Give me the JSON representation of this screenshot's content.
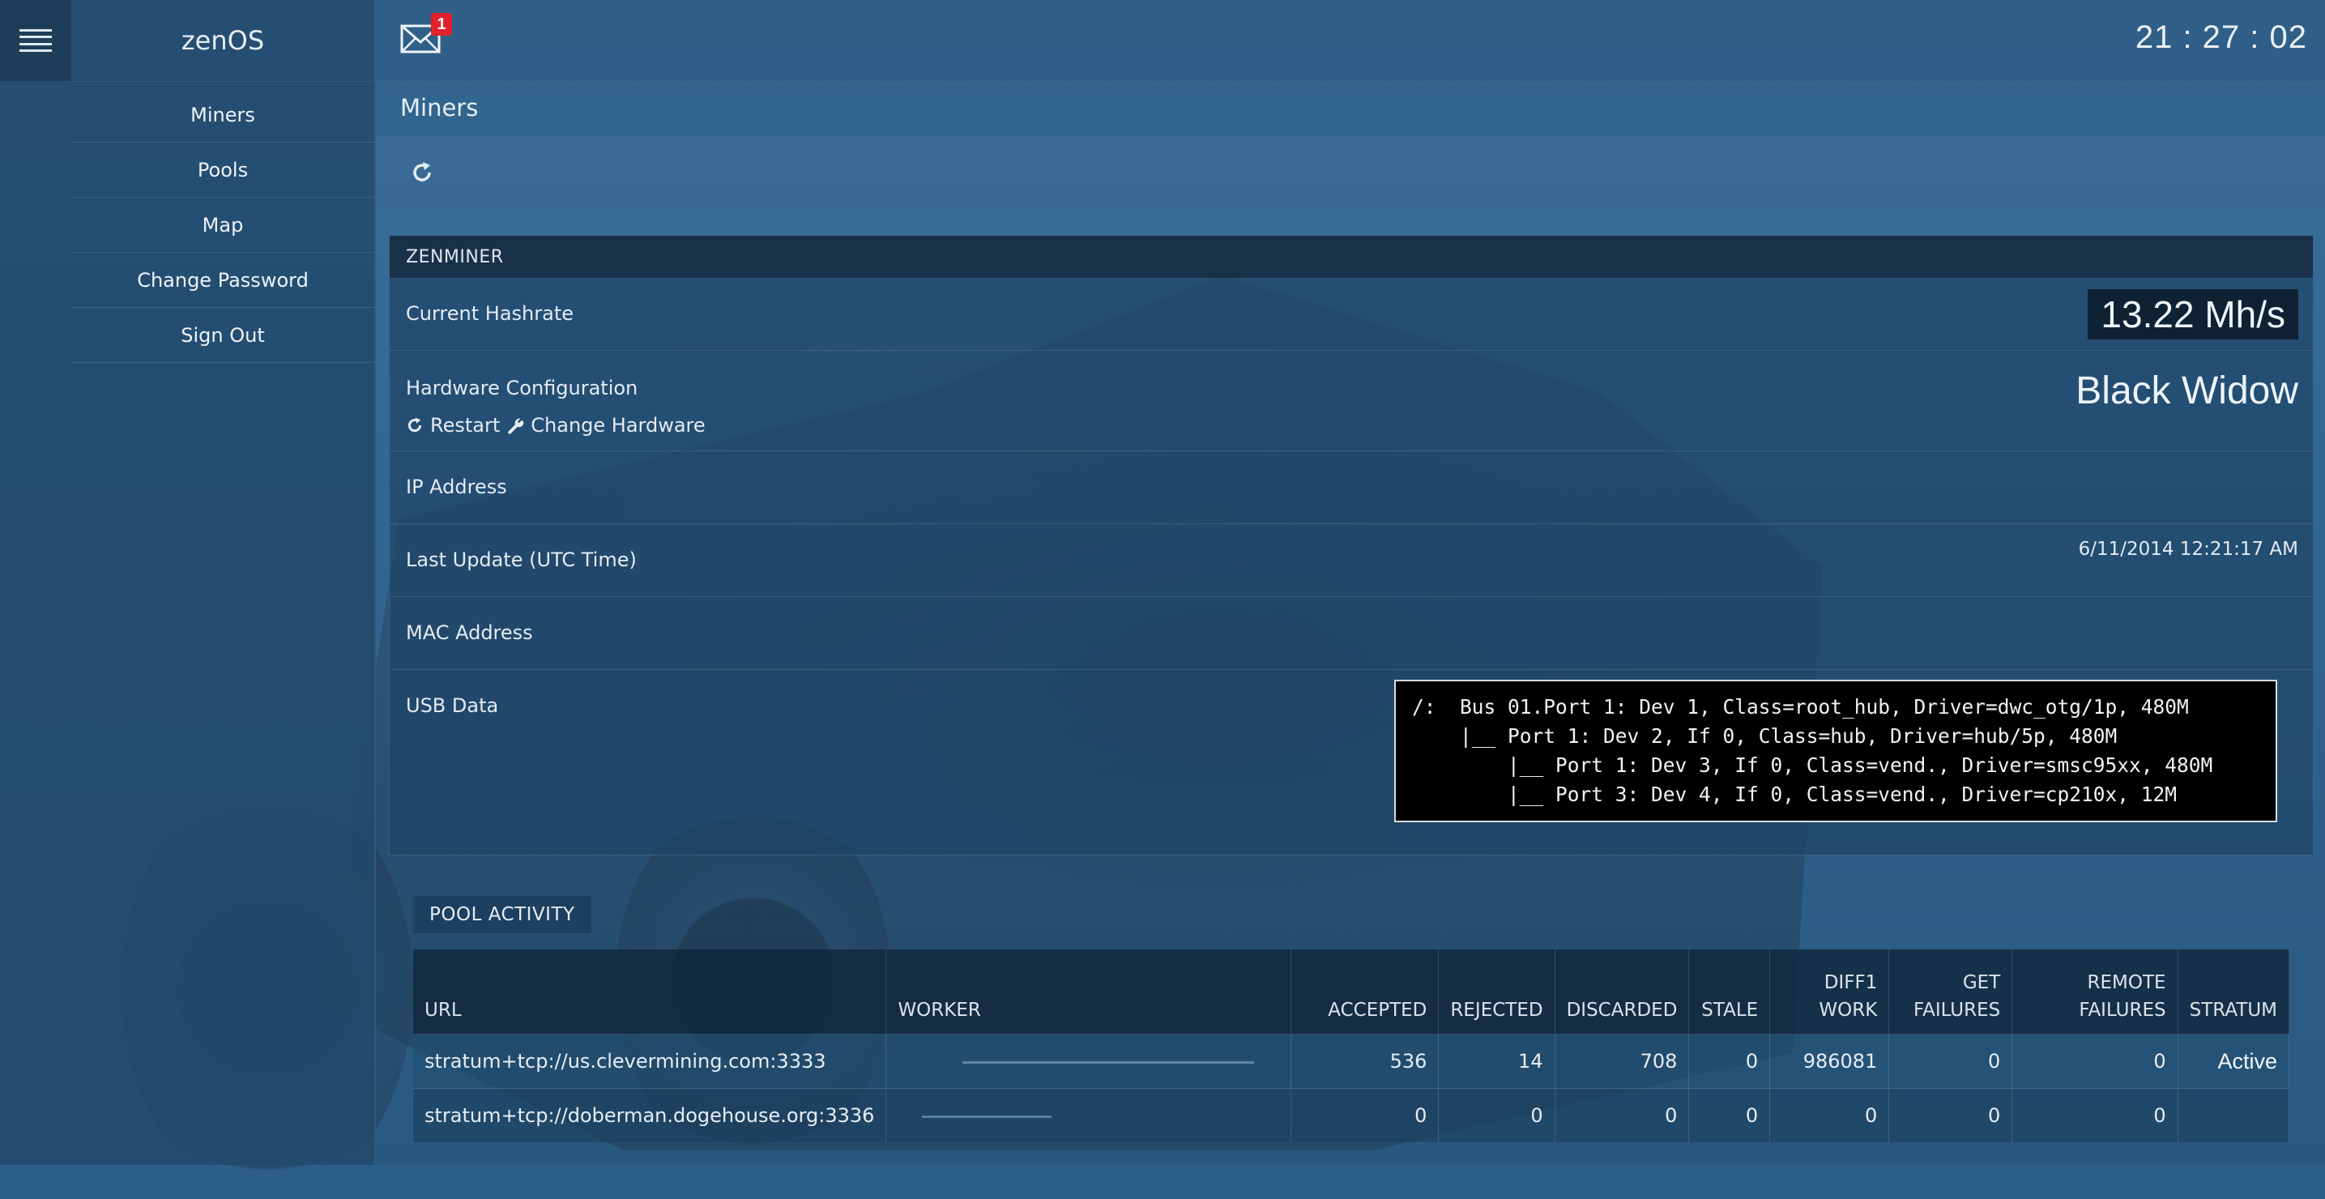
{
  "app": {
    "brand": "zenOS",
    "clock": "21 : 27 : 02",
    "mail_badge": "1"
  },
  "sidebar": {
    "items": [
      {
        "label": "Miners"
      },
      {
        "label": "Pools"
      },
      {
        "label": "Map"
      },
      {
        "label": "Change Password"
      },
      {
        "label": "Sign Out"
      }
    ]
  },
  "page": {
    "title": "Miners"
  },
  "miner": {
    "panel_title": "ZENMINER",
    "hashrate_label": "Current Hashrate",
    "hashrate_value": "13.22 Mh/s",
    "hw_label": "Hardware Configuration",
    "hw_value": "Black Widow",
    "restart_label": "Restart",
    "change_hw_label": "Change Hardware",
    "ip_label": "IP Address",
    "last_update_label": "Last Update (UTC Time)",
    "last_update_value": "6/11/2014 12:21:17 AM",
    "mac_label": "MAC Address",
    "usb_label": "USB Data",
    "usb_lines": [
      "/:  Bus 01.Port 1: Dev 1, Class=root_hub, Driver=dwc_otg/1p, 480M",
      "    |__ Port 1: Dev 2, If 0, Class=hub, Driver=hub/5p, 480M",
      "        |__ Port 1: Dev 3, If 0, Class=vend., Driver=smsc95xx, 480M",
      "        |__ Port 3: Dev 4, If 0, Class=vend., Driver=cp210x, 12M"
    ]
  },
  "pool": {
    "title": "POOL ACTIVITY",
    "headers": {
      "url": "URL",
      "worker": "WORKER",
      "accepted": "ACCEPTED",
      "rejected": "REJECTED",
      "discarded": "DISCARDED",
      "stale": "STALE",
      "diff1_a": "DIFF1",
      "diff1_b": "WORK",
      "get_a": "GET",
      "get_b": "FAILURES",
      "remote_a": "REMOTE",
      "remote_b": "FAILURES",
      "stratum": "STRATUM"
    },
    "rows": [
      {
        "url": "stratum+tcp://us.clevermining.com:3333",
        "worker": "",
        "accepted": "536",
        "rejected": "14",
        "discarded": "708",
        "stale": "0",
        "diff1": "986081",
        "get_failures": "0",
        "remote_failures": "0",
        "stratum": "Active"
      },
      {
        "url": "stratum+tcp://doberman.dogehouse.org:3336",
        "worker": "",
        "accepted": "0",
        "rejected": "0",
        "discarded": "0",
        "stale": "0",
        "diff1": "0",
        "get_failures": "0",
        "remote_failures": "0",
        "stratum": ""
      }
    ]
  },
  "colors": {
    "background": "#2c5f8a",
    "sidebar": "#224a6c",
    "badge": "#e0202a",
    "usb_box": "#000000"
  },
  "icons": {
    "menu": "hamburger-icon",
    "mail": "envelope-icon",
    "refresh": "refresh-icon",
    "restart": "refresh-icon",
    "change_hw": "wrench-icon"
  }
}
